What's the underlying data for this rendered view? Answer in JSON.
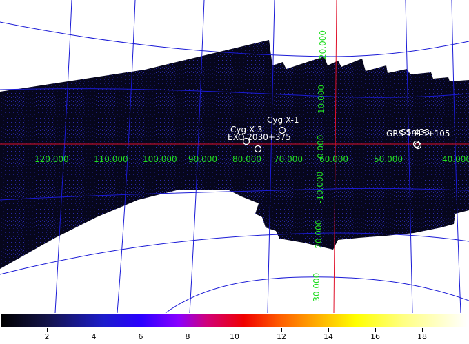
{
  "map": {
    "lon_labels": [
      "120.000",
      "110.000",
      "100.000",
      "90.000",
      "80.000",
      "70.000",
      "60.000",
      "50.000",
      "40.000"
    ],
    "lat_labels": [
      "20.000",
      "10.000",
      "0.000",
      "-10.000",
      "-20.000",
      "-30.000"
    ],
    "sources": [
      {
        "name": "Cyg X-1"
      },
      {
        "name": "Cyg X-3"
      },
      {
        "name": "EXO 2030+375"
      },
      {
        "name": "GRS 1915+105"
      },
      {
        "name": "SS 433"
      }
    ],
    "colors": {
      "grid": "#1a1ad6",
      "axes": "#e0102a",
      "labels": "#22dd22",
      "exposure": "#0b0b28"
    }
  },
  "colorbar": {
    "ticks": [
      "2",
      "4",
      "6",
      "8",
      "10",
      "12",
      "14",
      "16",
      "18"
    ],
    "colormap": "heat"
  }
}
